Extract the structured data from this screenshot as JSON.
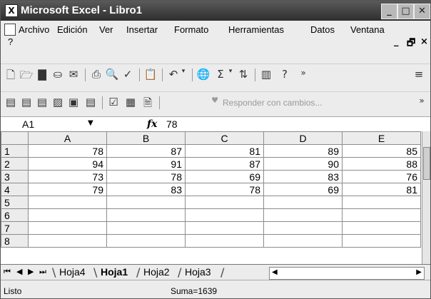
{
  "window": {
    "title": "Microsoft Excel - Libro1"
  },
  "menu": {
    "items": [
      "Archivo",
      "Edición",
      "Ver",
      "Insertar",
      "Formato",
      "Herramientas",
      "Datos",
      "Ventana"
    ],
    "help": "?"
  },
  "toolbar2": {
    "review_label": "Responder con cambios..."
  },
  "formula_bar": {
    "cell_ref": "A1",
    "fx": "fx",
    "value": "78"
  },
  "sheet": {
    "columns": [
      "A",
      "B",
      "C",
      "D",
      "E"
    ],
    "rows": [
      {
        "n": "1",
        "cells": [
          "78",
          "87",
          "81",
          "89",
          "85"
        ]
      },
      {
        "n": "2",
        "cells": [
          "94",
          "91",
          "87",
          "90",
          "88"
        ]
      },
      {
        "n": "3",
        "cells": [
          "73",
          "78",
          "69",
          "83",
          "76"
        ]
      },
      {
        "n": "4",
        "cells": [
          "79",
          "83",
          "78",
          "69",
          "81"
        ]
      },
      {
        "n": "5",
        "cells": [
          "",
          "",
          "",
          "",
          ""
        ]
      },
      {
        "n": "6",
        "cells": [
          "",
          "",
          "",
          "",
          ""
        ]
      },
      {
        "n": "7",
        "cells": [
          "",
          "",
          "",
          "",
          ""
        ]
      },
      {
        "n": "8",
        "cells": [
          "",
          "",
          "",
          "",
          ""
        ]
      }
    ]
  },
  "tabs": [
    "Hoja4",
    "Hoja1",
    "Hoja2",
    "Hoja3"
  ],
  "active_tab": "Hoja1",
  "status": {
    "text": "Listo",
    "sum": "Suma=1639"
  }
}
